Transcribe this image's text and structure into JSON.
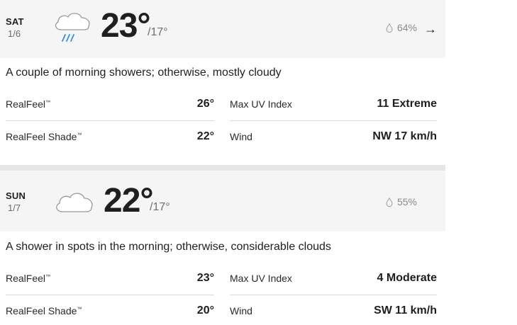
{
  "days": [
    {
      "day": "SAT",
      "date": "1/6",
      "icon": "rain-cloud-icon",
      "high": "23°",
      "low": "/17°",
      "precip": "64%",
      "phrase": "A couple of morning showers; otherwise, mostly cloudy",
      "details": {
        "realfeel_label": "RealFeel",
        "realfeel_value": "26°",
        "realfeel_shade_label": "RealFeel Shade",
        "realfeel_shade_value": "22°",
        "max_uv_label": "Max UV Index",
        "max_uv_value": "11 Extreme",
        "wind_label": "Wind",
        "wind_value": "NW 17 km/h"
      },
      "arrow": "→"
    },
    {
      "day": "SUN",
      "date": "1/7",
      "icon": "cloud-icon",
      "high": "22°",
      "low": "/17°",
      "precip": "55%",
      "phrase": "A shower in spots in the morning; otherwise, considerable clouds",
      "details": {
        "realfeel_label": "RealFeel",
        "realfeel_value": "23°",
        "realfeel_shade_label": "RealFeel Shade",
        "realfeel_shade_value": "20°",
        "max_uv_label": "Max UV Index",
        "max_uv_value": "4 Moderate",
        "wind_label": "Wind",
        "wind_value": "SW 11 km/h"
      }
    }
  ],
  "trademark": "™"
}
